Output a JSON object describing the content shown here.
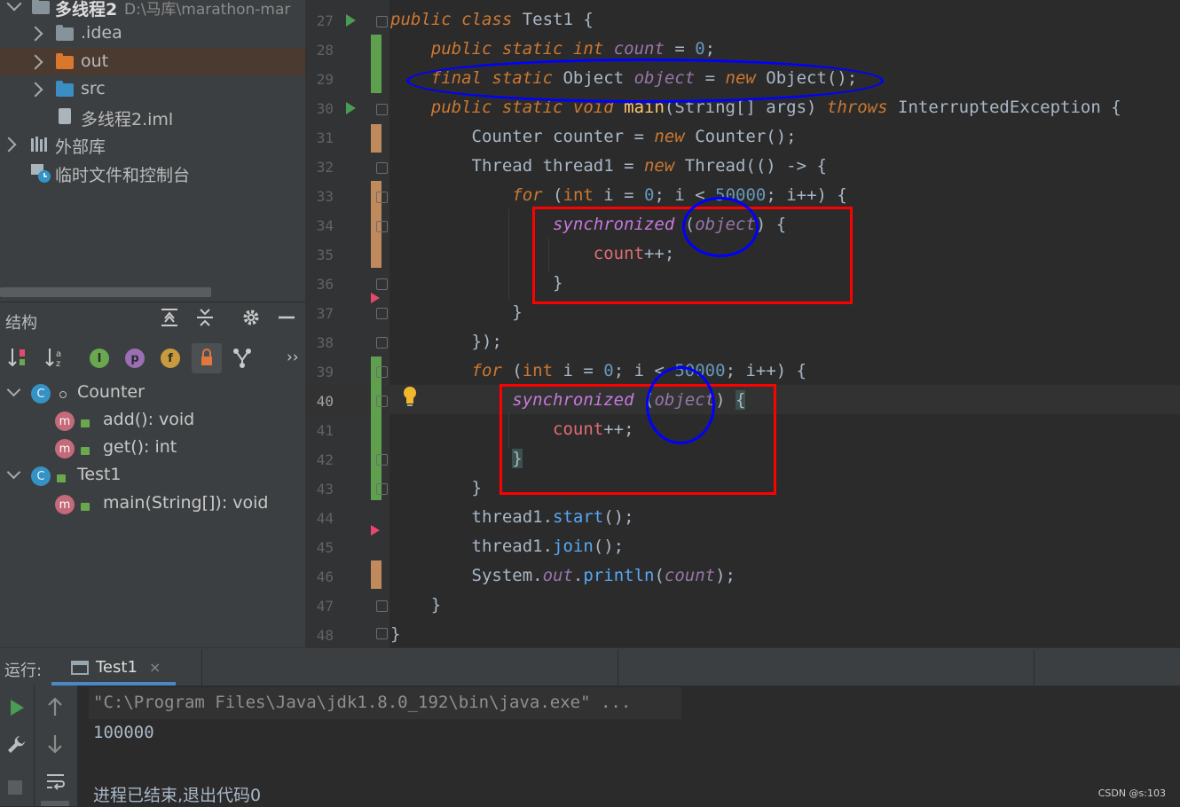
{
  "project_tree": {
    "root_name": "多线程2",
    "root_path": "D:\\马库\\marathon-mar",
    "items": [
      {
        "label": ".idea"
      },
      {
        "label": "out"
      },
      {
        "label": "src"
      },
      {
        "label": "多线程2.iml"
      },
      {
        "label": "外部库"
      },
      {
        "label": "临时文件和控制台"
      }
    ]
  },
  "structure": {
    "title": "结构",
    "class1": "Counter",
    "class1_icon": "C",
    "method1": "add(): void",
    "method2": "get(): int",
    "class2": "Test1",
    "class2_icon": "C",
    "method3": "main(String[]): void",
    "method_icon": "m",
    "filter_p": "p",
    "filter_f": "f",
    "more": "››"
  },
  "editor": {
    "line_numbers": [
      "27",
      "28",
      "29",
      "30",
      "31",
      "32",
      "33",
      "34",
      "35",
      "36",
      "37",
      "38",
      "39",
      "40",
      "41",
      "42",
      "43",
      "44",
      "45",
      "46",
      "47",
      "48"
    ]
  },
  "run": {
    "label": "运行:",
    "tab": "Test1",
    "close": "×",
    "cmd": "\"C:\\Program Files\\Java\\jdk1.8.0_192\\bin\\java.exe\" ...",
    "output": "100000",
    "exit": "进程已结束,退出代码0"
  },
  "watermark": "CSDN @s:103"
}
